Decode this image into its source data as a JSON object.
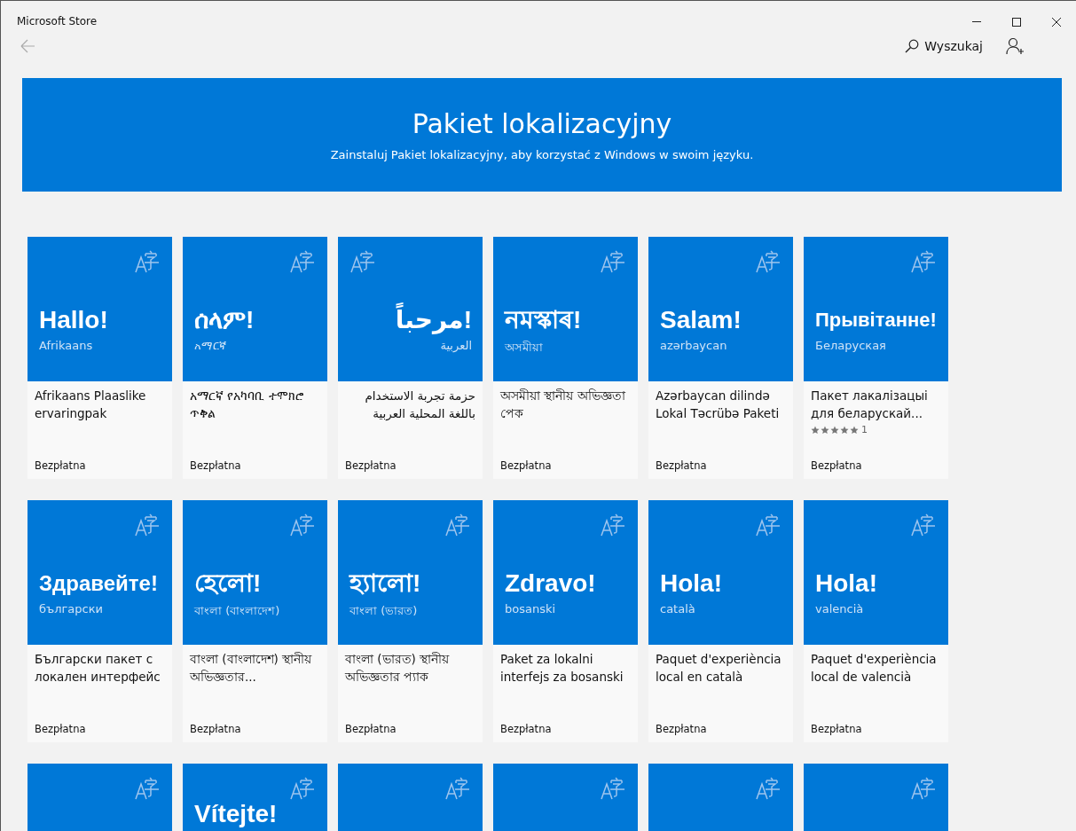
{
  "window": {
    "title": "Microsoft Store",
    "controls": [
      {
        "kind": "minimize"
      },
      {
        "kind": "maximize"
      },
      {
        "kind": "close"
      }
    ]
  },
  "nav": {
    "search_label": "Wyszukaj"
  },
  "banner": {
    "title": "Pakiet lokalizacyjny",
    "subtitle": "Zainstaluj Pakiet lokalizacyjny, aby korzystać z Windows w swoim języku."
  },
  "tiles": [
    {
      "kind": "full",
      "greeting": "Hallo!",
      "language": "Afrikaans",
      "name": "Afrikaans Plaaslike ervaringpak",
      "price": "Bezpłatna"
    },
    {
      "kind": "full",
      "greeting": "ሰላም!",
      "language": "አማርኛ",
      "name": "አማርኛ የአካባቢ ተሞክሮ ጥቅል",
      "price": "Bezpłatna"
    },
    {
      "kind": "full",
      "greeting": "!مرحباً",
      "language": "العربية",
      "name": "حزمة تجربة الاستخدام باللغة المحلية العربية",
      "price": "Bezpłatna"
    },
    {
      "kind": "full",
      "greeting": "নমস্কাৰ!",
      "language": "অসমীয়া",
      "name": "অসমীয়া স্থানীয় অভিজ্ঞতা পেক",
      "price": "Bezpłatna"
    },
    {
      "kind": "full",
      "greeting": "Salam!",
      "language": "azərbaycan",
      "name": "Azərbaycan dilində Lokal Təcrübə Paketi",
      "price": "Bezpłatna"
    },
    {
      "kind": "full",
      "greeting": "Прывітанне!",
      "language": "Беларуская",
      "name": "Пакет лакалізацыі для беларускай...",
      "stars": 5,
      "rating_count": "1",
      "price": "Bezpłatna"
    },
    {
      "kind": "full",
      "greeting": "Здравейте!",
      "language": "български",
      "name": "Български пакет с локален интерфейс",
      "price": "Bezpłatna"
    },
    {
      "kind": "full",
      "greeting": "হেলো!",
      "language": "বাংলা (বাংলাদেশ)",
      "name": "বাংলা (বাংলাদেশ) স্থানীয় অভিজ্ঞতার...",
      "price": "Bezpłatna"
    },
    {
      "kind": "full",
      "greeting": "হ্যালো!",
      "language": "বাংলা (ভারত)",
      "name": "বাংলা (ভারত) স্থানীয় অভিজ্ঞতার প্যাক",
      "price": "Bezpłatna"
    },
    {
      "kind": "full",
      "greeting": "Zdravo!",
      "language": "bosanski",
      "name": "Paket za lokalni interfejs za bosanski",
      "price": "Bezpłatna"
    },
    {
      "kind": "full",
      "greeting": "Hola!",
      "language": "català",
      "name": "Paquet d'experiència local en català",
      "price": "Bezpłatna"
    },
    {
      "kind": "full",
      "greeting": "Hola!",
      "language": "valencià",
      "name": "Paquet d'experiència local de valencià",
      "price": "Bezpłatna"
    },
    {
      "kind": "partial"
    },
    {
      "kind": "partial",
      "greeting": "Vítejte!"
    },
    {
      "kind": "partial"
    },
    {
      "kind": "partial"
    },
    {
      "kind": "partial"
    },
    {
      "kind": "partial"
    }
  ]
}
